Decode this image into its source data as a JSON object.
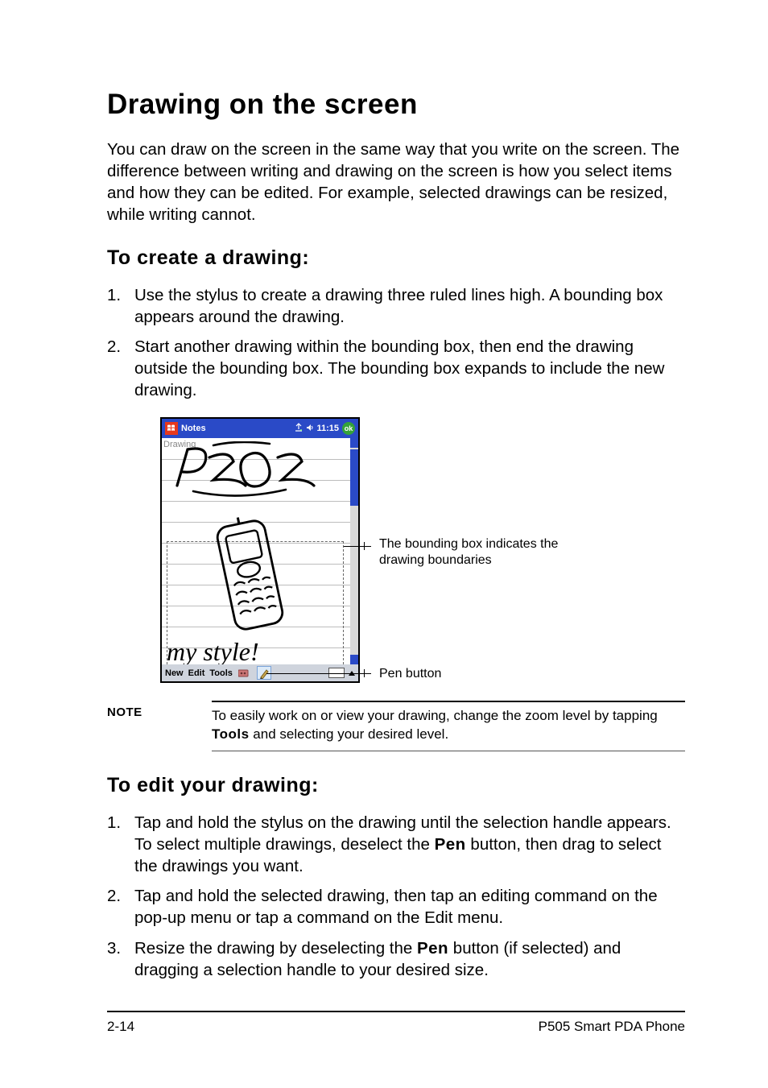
{
  "heading": "Drawing on the screen",
  "intro": "You can draw on the screen in the same way that you write on the screen. The difference between writing and drawing on the screen is how you select items and how they can be edited. For example, selected drawings can be resized, while writing cannot.",
  "section_create": {
    "title": "To create a drawing:",
    "steps": [
      "Use the stylus to create a drawing three ruled lines high. A bounding box appears around the drawing.",
      "Start another drawing within the bounding box, then end the drawing outside the bounding box. The bounding box expands to include the new drawing."
    ]
  },
  "device": {
    "app_title": "Notes",
    "status_time": "11:15",
    "ok": "ok",
    "corner_label": "Drawing",
    "menubar": {
      "new": "New",
      "edit": "Edit",
      "tools": "Tools"
    }
  },
  "callouts": {
    "bounding": "The bounding box indicates the drawing boundaries",
    "pen": "Pen button"
  },
  "note": {
    "label": "NOTE",
    "text_before": "To easily work on or view your drawing, change the zoom level by tapping ",
    "tools": "Tools",
    "text_after": " and selecting your desired level."
  },
  "section_edit": {
    "title": "To edit your drawing:",
    "steps": [
      {
        "pre": "Tap and hold the stylus on the drawing until the selection handle appears. To select multiple drawings, deselect the ",
        "bold": "Pen",
        "post": " button, then drag to select the drawings you want."
      },
      {
        "pre": "Tap and hold the selected drawing, then tap an editing command on the pop-up menu or tap a command on the Edit menu.",
        "bold": "",
        "post": ""
      },
      {
        "pre": "Resize the drawing by deselecting the ",
        "bold": "Pen",
        "post": " button (if selected) and dragging a selection handle to your desired size."
      }
    ]
  },
  "footer": {
    "page": "2-14",
    "product": "P505 Smart PDA Phone"
  }
}
